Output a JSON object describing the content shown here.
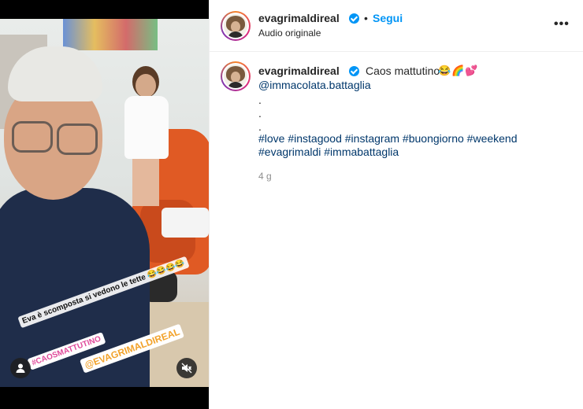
{
  "post": {
    "username": "evagrimaldireal",
    "follow_label": "Segui",
    "separator": "•",
    "audio_label": "Audio originale",
    "more_label": "•••"
  },
  "caption": {
    "username": "evagrimaldireal",
    "text": "Caos mattutino",
    "emojis": [
      "😂",
      "🌈",
      "💕"
    ],
    "mention": "@immacolata.battaglia",
    "dots": [
      ".",
      ".",
      "."
    ],
    "hashtags_line1": [
      "#love",
      "#instagood",
      "#instagram",
      "#buongiorno",
      "#weekend"
    ],
    "hashtags_line2": [
      "#evagrimaldi",
      "#immabattaglia"
    ],
    "timestamp": "4 g"
  },
  "video": {
    "sticker_text": "Eva è scomposta si vedono le tette 😂😂😂😂",
    "sticker_hashtag": "#CAOSMATTUTINO",
    "sticker_mention": "@EVAGRIMALDIREAL",
    "user_icon": "user-tags-icon",
    "mute_icon": "muted-speaker-icon"
  },
  "colors": {
    "link": "#00376b",
    "follow": "#0095f6",
    "verified": "#0095f6"
  }
}
